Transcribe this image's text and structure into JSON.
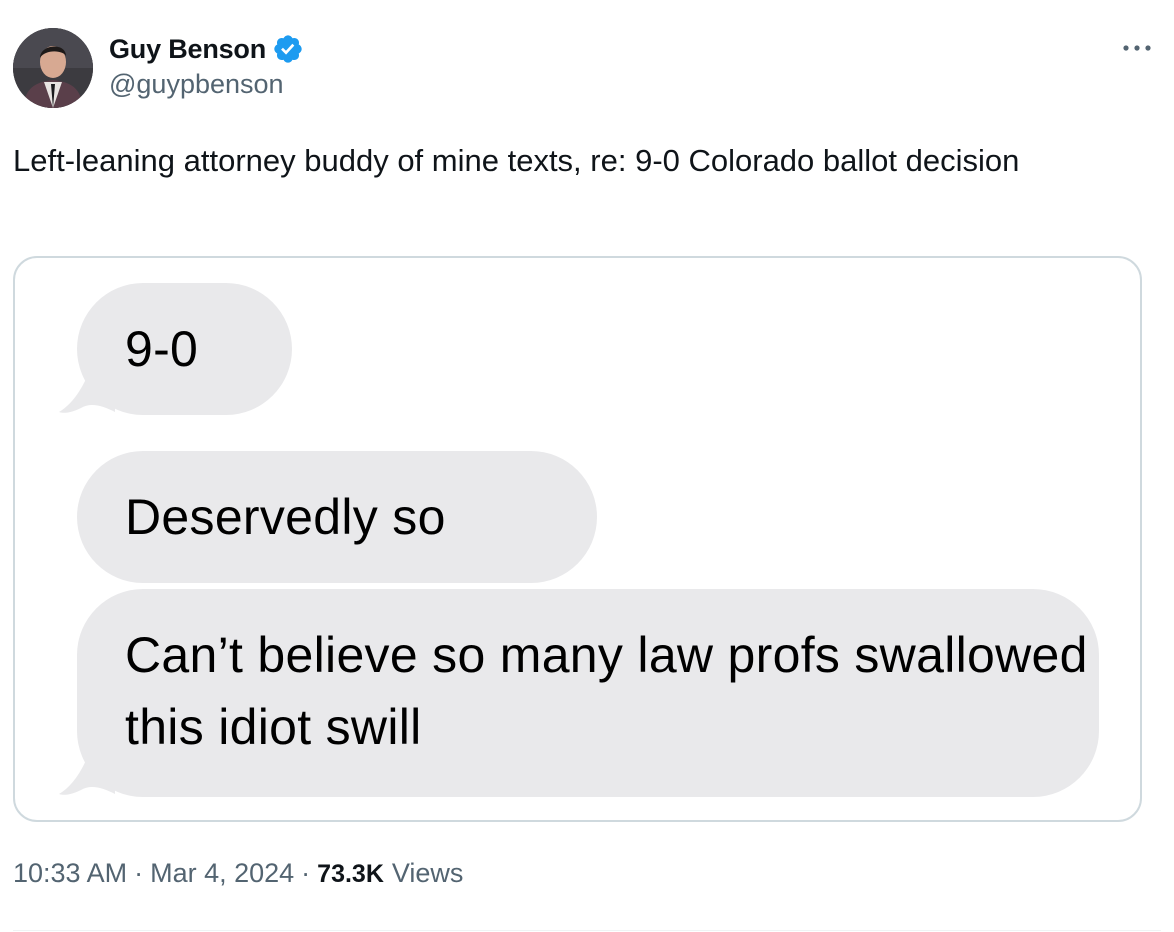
{
  "author": {
    "display_name": "Guy Benson",
    "handle": "@guypbenson",
    "verified": true,
    "verified_color": "#1d9bf0"
  },
  "more_icon": "more-horizontal-icon",
  "tweet": {
    "text": "Left-leaning attorney buddy of mine texts, re: 9-0 Colorado ballot decision"
  },
  "media": {
    "messages": [
      {
        "text": "9-0"
      },
      {
        "text": "Deservedly so"
      },
      {
        "text": "Can’t believe so many law profs swallowed this idiot swill"
      }
    ],
    "bubble_color": "#e9e9eb"
  },
  "footer": {
    "time": "10:33 AM",
    "separator": "·",
    "date": "Mar 4, 2024",
    "views_count": "73.3K",
    "views_label": "Views"
  }
}
